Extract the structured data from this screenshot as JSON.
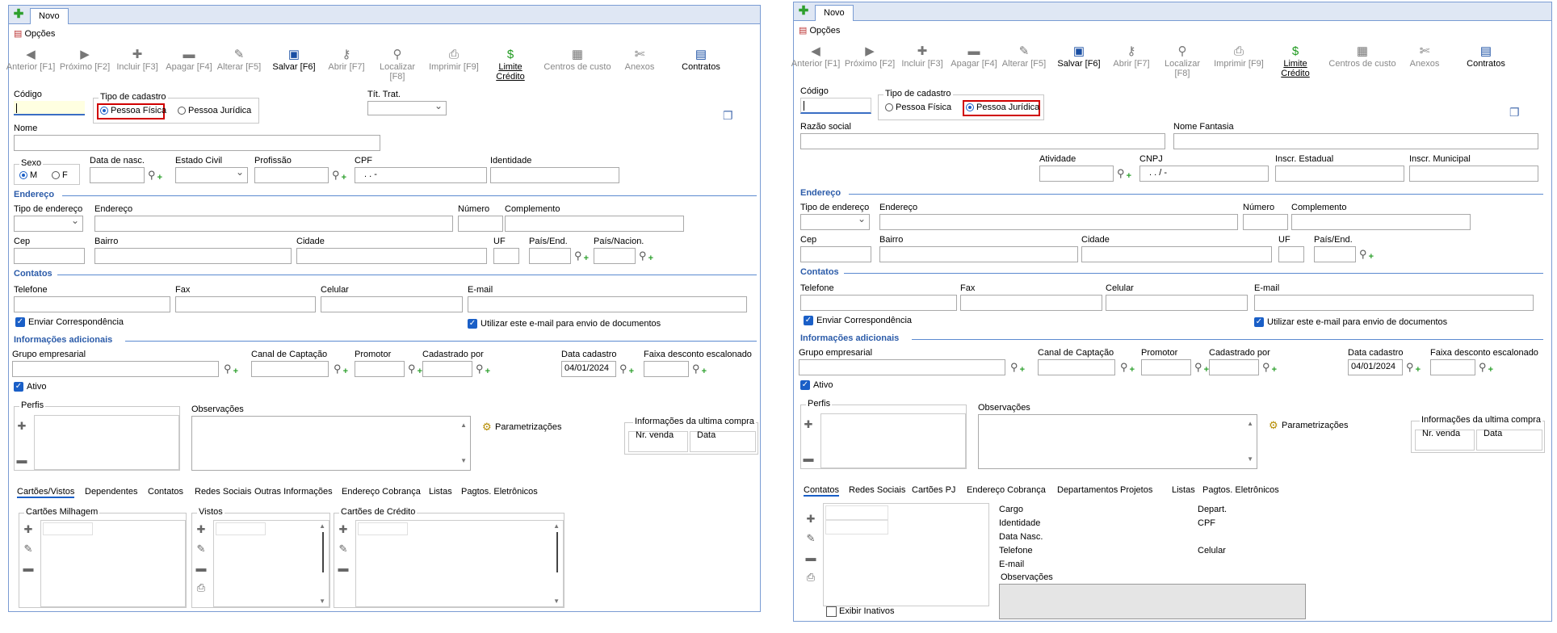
{
  "left": {
    "tab": "Novo",
    "options": "Opções",
    "toolbar": [
      {
        "icon": "back-arrow-icon",
        "label": "Anterior [F1]",
        "enabled": false
      },
      {
        "icon": "forward-arrow-icon",
        "label": "Próximo [F2]",
        "enabled": false
      },
      {
        "icon": "plus-icon",
        "label": "Incluir [F3]",
        "enabled": false
      },
      {
        "icon": "minus-icon",
        "label": "Apagar [F4]",
        "enabled": false
      },
      {
        "icon": "edit-icon",
        "label": "Alterar [F5]",
        "enabled": false
      },
      {
        "icon": "save-icon",
        "label": "Salvar [F6]",
        "enabled": true
      },
      {
        "icon": "key-icon",
        "label": "Abrir [F7]",
        "enabled": false
      },
      {
        "icon": "search-icon",
        "label": "Localizar [F8]",
        "enabled": false
      },
      {
        "icon": "printer-icon",
        "label": "Imprimir [F9]",
        "enabled": false
      },
      {
        "icon": "dollar-icon",
        "label": "Limite Crédito",
        "enabled": true
      },
      {
        "icon": "cost-centers-icon",
        "label": "Centros de custo",
        "enabled": false
      },
      {
        "icon": "paperclip-icon",
        "label": "Anexos",
        "enabled": false
      },
      {
        "icon": "contracts-icon",
        "label": "Contratos",
        "enabled": true
      }
    ],
    "codigo": "Código",
    "tipo_cadastro": "Tipo de cadastro",
    "pf": "Pessoa Física",
    "pj": "Pessoa Jurídica",
    "tit_trat": "Tít. Trat.",
    "nome": "Nome",
    "sexo": "Sexo",
    "sexo_m": "M",
    "sexo_f": "F",
    "data_nasc": "Data de nasc.",
    "estado_civil": "Estado Civil",
    "profissao": "Profissão",
    "cpf": "CPF",
    "cpf_mask": ".   .   -",
    "identidade": "Identidade",
    "endereco_section": "Endereço",
    "tipo_endereco": "Tipo de endereço",
    "endereco": "Endereço",
    "numero": "Número",
    "complemento": "Complemento",
    "cep": "Cep",
    "bairro": "Bairro",
    "cidade": "Cidade",
    "uf": "UF",
    "pais_end": "País/End.",
    "pais_nacion": "País/Nacion.",
    "contatos_section": "Contatos",
    "telefone": "Telefone",
    "fax": "Fax",
    "celular": "Celular",
    "email": "E-mail",
    "enviar_corr": "Enviar Correspondência",
    "utilizar_email": "Utilizar este e-mail para envio de documentos",
    "info_section": "Informações adicionais",
    "grupo": "Grupo empresarial",
    "canal": "Canal de Captação",
    "promotor": "Promotor",
    "cadastrado_por": "Cadastrado por",
    "data_cadastro": "Data cadastro",
    "data_cadastro_val": "04/01/2024",
    "faixa": "Faixa desconto escalonado",
    "ativo": "Ativo",
    "perfis": "Perfis",
    "observacoes": "Observações",
    "parametrizacoes": "Parametrizações",
    "ultima_compra": "Informações da ultima compra",
    "nr_venda": "Nr. venda",
    "data": "Data",
    "subtabs": [
      "Cartões/Vistos",
      "Dependentes",
      "Contatos",
      "Redes Sociais",
      "Outras Informações",
      "Endereço Cobrança",
      "Listas",
      "Pagtos. Eletrônicos"
    ],
    "cartoes_milhagem": "Cartões Milhagem",
    "vistos": "Vistos",
    "cartoes_credito": "Cartões de Crédito"
  },
  "right": {
    "tab": "Novo",
    "options": "Opções",
    "codigo": "Código",
    "tipo_cadastro": "Tipo de cadastro",
    "pf": "Pessoa Física",
    "pj": "Pessoa Jurídica",
    "razao_social": "Razão social",
    "nome_fantasia": "Nome Fantasia",
    "atividade": "Atividade",
    "cnpj": "CNPJ",
    "cnpj_mask": ".   .   /   -",
    "insc_estadual": "Inscr. Estadual",
    "insc_municipal": "Inscr. Municipal",
    "endereco_section": "Endereço",
    "tipo_endereco": "Tipo de endereço",
    "endereco": "Endereço",
    "numero": "Número",
    "complemento": "Complemento",
    "cep": "Cep",
    "bairro": "Bairro",
    "cidade": "Cidade",
    "uf": "UF",
    "pais_end": "País/End.",
    "contatos_section": "Contatos",
    "telefone": "Telefone",
    "fax": "Fax",
    "celular": "Celular",
    "email": "E-mail",
    "enviar_corr": "Enviar Correspondência",
    "utilizar_email": "Utilizar este e-mail para envio de documentos",
    "info_section": "Informações adicionais",
    "grupo": "Grupo empresarial",
    "canal": "Canal de Captação",
    "promotor": "Promotor",
    "cadastrado_por": "Cadastrado por",
    "data_cadastro": "Data cadastro",
    "data_cadastro_val": "04/01/2024",
    "faixa": "Faixa desconto escalonado",
    "ativo": "Ativo",
    "perfis": "Perfis",
    "observacoes": "Observações",
    "parametrizacoes": "Parametrizações",
    "ultima_compra": "Informações da ultima compra",
    "nr_venda": "Nr. venda",
    "data": "Data",
    "subtabs": [
      "Contatos",
      "Redes Sociais",
      "Cartões PJ",
      "Endereço Cobrança",
      "Departamentos",
      "Projetos",
      "Listas",
      "Pagtos. Eletrônicos"
    ],
    "cargo": "Cargo",
    "depart": "Depart.",
    "identidade": "Identidade",
    "cpf": "CPF",
    "data_nasc": "Data Nasc.",
    "telefone_c": "Telefone",
    "celular_c": "Celular",
    "email_c": "E-mail",
    "observacoes_c": "Observações",
    "exibir_inativos": "Exibir Inativos"
  }
}
